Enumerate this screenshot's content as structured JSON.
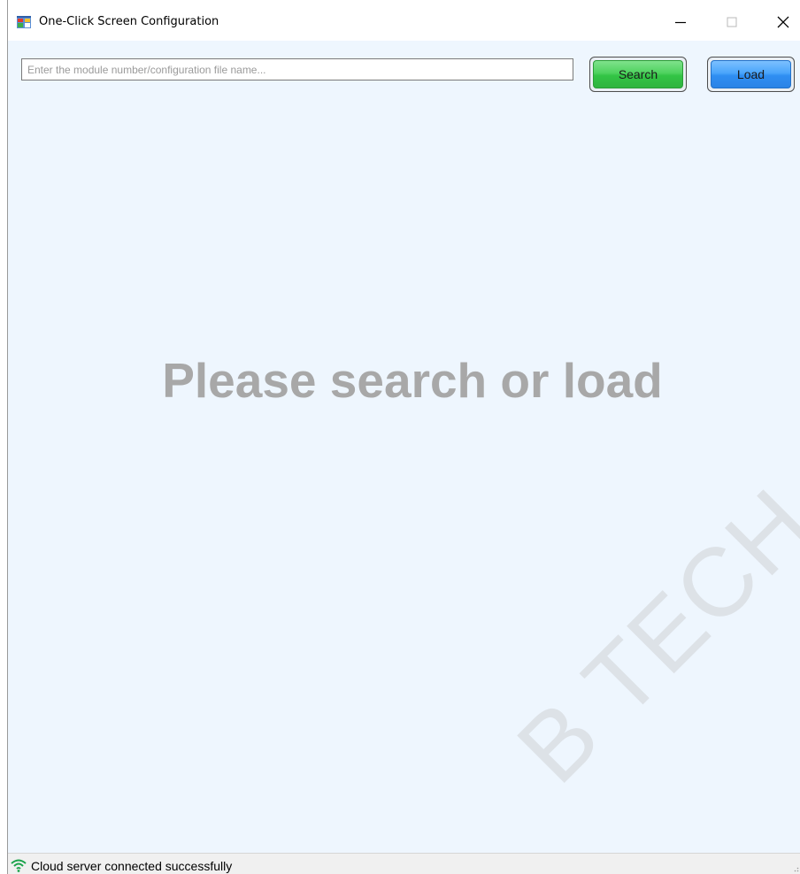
{
  "window": {
    "title": "One-Click Screen Configuration",
    "app_icon": "app-window-icon",
    "controls": {
      "minimize_icon": "minimize-icon",
      "maximize_icon": "maximize-icon",
      "close_icon": "close-icon"
    }
  },
  "toolbar": {
    "search_placeholder": "Enter the module number/configuration file name...",
    "search_value": "",
    "search_label": "Search",
    "load_label": "Load",
    "search_color": "#33c445",
    "load_color": "#2f8ef2"
  },
  "main": {
    "empty_message": "Please search or load"
  },
  "statusbar": {
    "icon": "wifi-icon",
    "text": "Cloud server connected successfully",
    "icon_color": "#1aa34a"
  },
  "watermark": {
    "text": "B TECH CO"
  }
}
